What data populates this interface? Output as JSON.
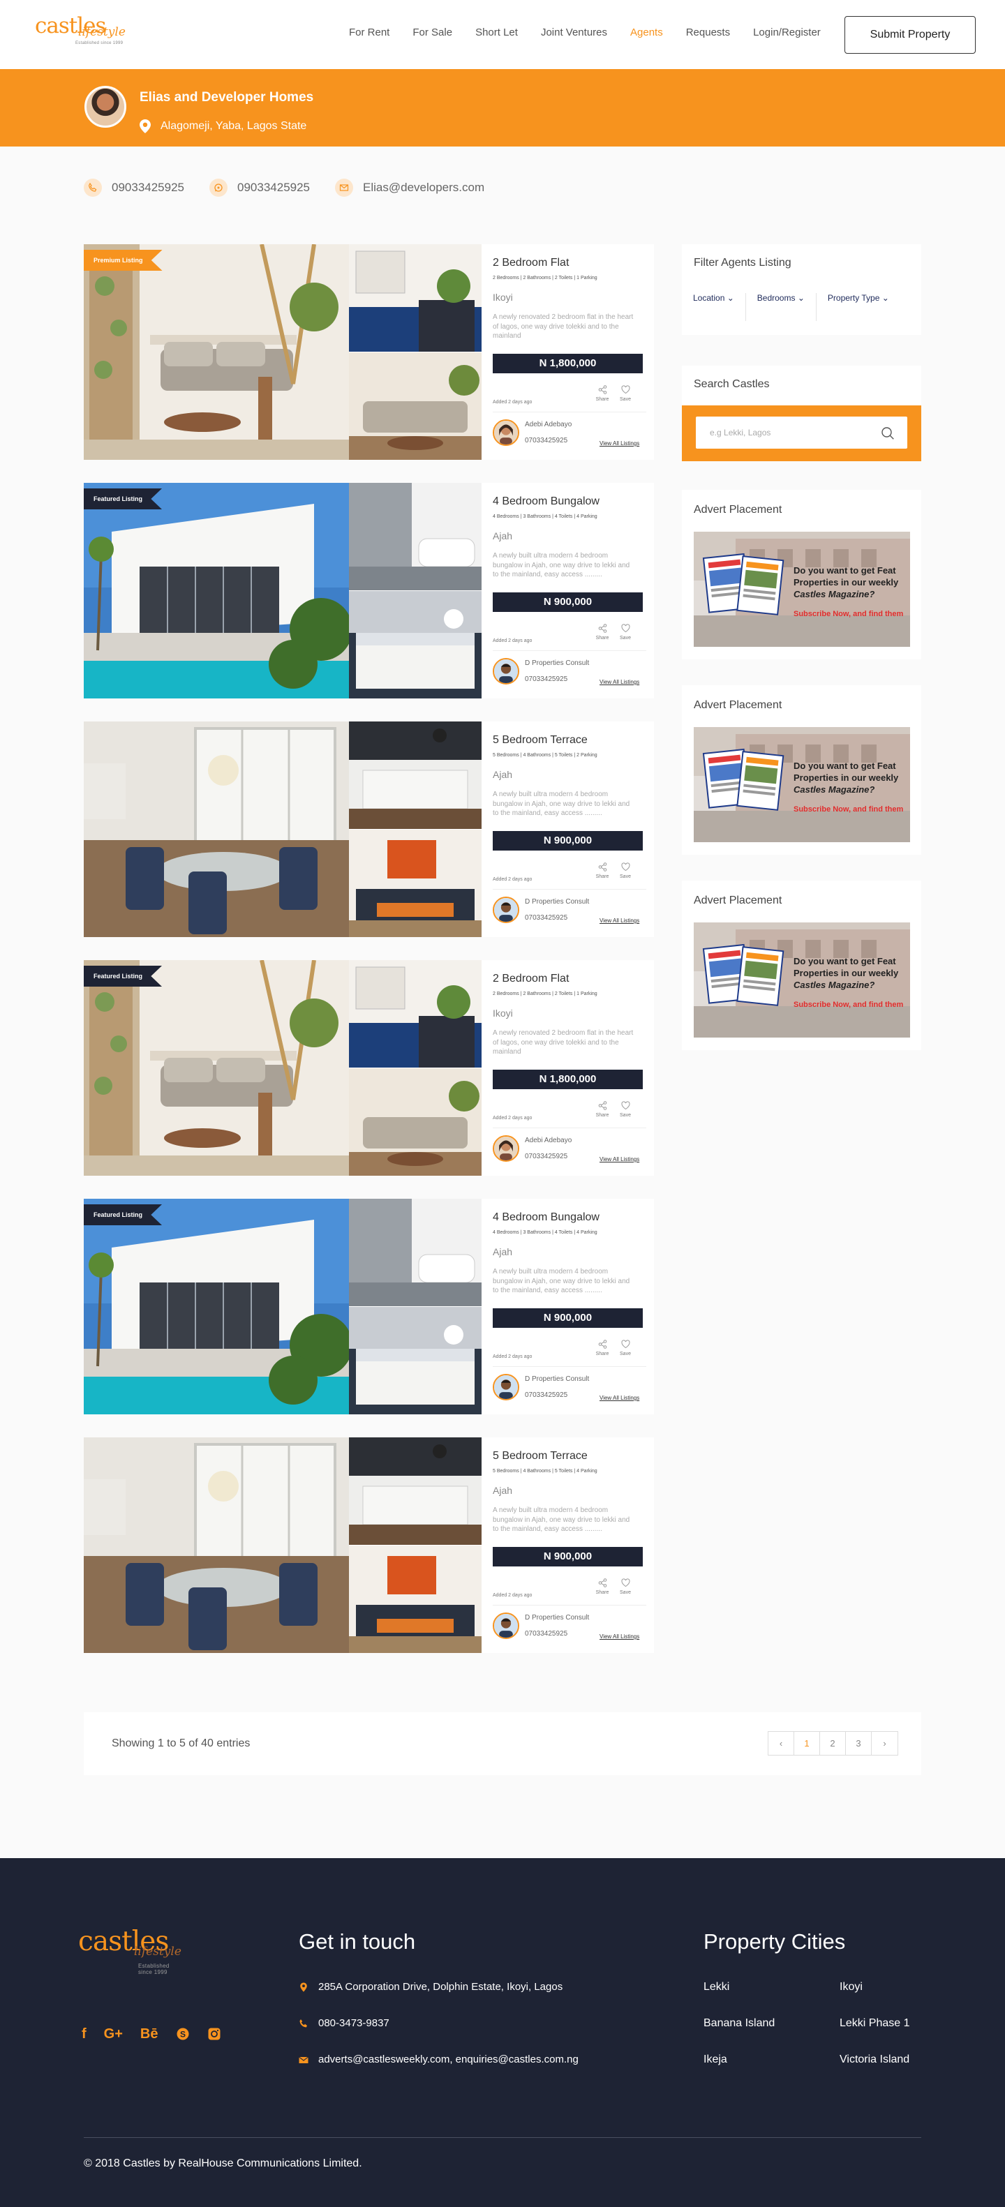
{
  "brand": {
    "name": "castles",
    "script": "lifestyle",
    "tagline": "Established since 1999"
  },
  "nav": {
    "items": [
      "For Rent",
      "For Sale",
      "Short Let",
      "Joint Ventures",
      "Agents",
      "Requests",
      "Login/Register"
    ],
    "active": "Agents",
    "submit_label": "Submit Property"
  },
  "agent": {
    "name": "Elias and Developer Homes",
    "location": "Alagomeji, Yaba, Lagos State",
    "phone": "09033425925",
    "whatsapp": "09033425925",
    "email": "Elias@developers.com"
  },
  "listings": [
    {
      "badge": "Premium Listing",
      "badge_type": "premium",
      "photo": "living",
      "title": "2 Bedroom Flat",
      "specs": "2 Bedrooms  |  2 Bathrooms  |  2 Toilets  | 1 Parking",
      "area": "Ikoyi",
      "description": "A newly renovated 2 bedroom flat in the heart of lagos, one way drive tolekki and to the mainland",
      "price": "N 1,800,000",
      "added": "Added 2 days ago",
      "share": "Share",
      "save": "Save",
      "owner": "Adebi Adebayo",
      "owner_phone": "07033425925",
      "owner_avatar": "woman",
      "view_all": "View All Listings"
    },
    {
      "badge": "Featured Listing",
      "badge_type": "featured",
      "photo": "pool",
      "title": "4 Bedroom Bungalow",
      "specs": "4 Bedrooms  |  3 Bathrooms  |  4 Toilets | 4 Parking",
      "area": "Ajah",
      "description": "A newly built ultra modern 4 bedroom bungalow in Ajah, one way drive to lekki and to the mainland, easy access .........",
      "price": "N 900,000",
      "added": "Added 2 days ago",
      "share": "Share",
      "save": "Save",
      "owner": "D Properties Consult",
      "owner_phone": "07033425925",
      "owner_avatar": "man",
      "view_all": "View All Listings"
    },
    {
      "badge": "",
      "badge_type": "none",
      "photo": "dining",
      "title": "5 Bedroom Terrace",
      "specs": "5 Bedrooms  |  4 Bathrooms  |  5 Toilets | 2 Parking",
      "area": "Ajah",
      "description": "A newly built ultra modern 4 bedroom bungalow in Ajah, one way drive to lekki and to the mainland, easy access .........",
      "price": "N 900,000",
      "added": "Added 2 days ago",
      "share": "Share",
      "save": "Save",
      "owner": "D Properties Consult",
      "owner_phone": "07033425925",
      "owner_avatar": "man",
      "view_all": "View All Listings"
    },
    {
      "badge": "Featured Listing",
      "badge_type": "featured",
      "photo": "living",
      "title": "2 Bedroom Flat",
      "specs": "2 Bedrooms  |  2 Bathrooms  |  2 Toilets  | 1 Parking",
      "area": "Ikoyi",
      "description": "A newly renovated 2 bedroom flat in the heart of lagos, one way drive tolekki and to the mainland",
      "price": "N 1,800,000",
      "added": "Added 2 days ago",
      "share": "Share",
      "save": "Save",
      "owner": "Adebi Adebayo",
      "owner_phone": "07033425925",
      "owner_avatar": "woman",
      "view_all": "View All Listings"
    },
    {
      "badge": "Featured Listing",
      "badge_type": "featured",
      "photo": "pool",
      "title": "4 Bedroom Bungalow",
      "specs": "4 Bedrooms  |  3 Bathrooms  |  4 Toilets | 4 Parking",
      "area": "Ajah",
      "description": "A newly built ultra modern 4 bedroom bungalow in Ajah, one way drive to lekki and to the mainland, easy access .........",
      "price": "N 900,000",
      "added": "Added 2 days ago",
      "share": "Share",
      "save": "Save",
      "owner": "D Properties Consult",
      "owner_phone": "07033425925",
      "owner_avatar": "man",
      "view_all": "View All Listings"
    },
    {
      "badge": "",
      "badge_type": "none",
      "photo": "dining",
      "title": "5 Bedroom Terrace",
      "specs": "5 Bedrooms  |  4 Bathrooms  |  5 Toilets | 4 Parking",
      "area": "Ajah",
      "description": "A newly built ultra modern 4 bedroom bungalow in Ajah, one way drive to lekki and to the mainland, easy access .........",
      "price": "N 900,000",
      "added": "Added 2 days ago",
      "share": "Share",
      "save": "Save",
      "owner": "D Properties Consult",
      "owner_phone": "07033425925",
      "owner_avatar": "man",
      "view_all": "View All Listings"
    }
  ],
  "sidebar": {
    "filter_title": "Filter Agents Listing",
    "filters": [
      "Location",
      "Bedrooms",
      "Property Type"
    ],
    "search_title": "Search Castles",
    "search_placeholder": "e.g Lekki, Lagos",
    "advert_title": "Advert Placement",
    "advert_text": [
      "Do you want to get Feat",
      "Properties in our weekly",
      "Castles Magazine?"
    ],
    "advert_cta": "Subscribe Now, and find them"
  },
  "pagination": {
    "showing": "Showing 1 to 5 of 40 entries",
    "pages": [
      "‹",
      "1",
      "2",
      "3",
      "›"
    ],
    "active_page": "1"
  },
  "footer": {
    "contact_title": "Get in touch",
    "address": "285A Corporation Drive, Dolphin Estate, Ikoyi, Lagos",
    "phone": "080-3473-9837",
    "email": "adverts@castlesweekly.com, enquiries@castles.com.ng",
    "cities_title": "Property Cities",
    "cities": [
      "Lekki",
      "Ikoyi",
      "Banana Island",
      "Lekki Phase 1",
      "Ikeja",
      "Victoria Island"
    ],
    "copyright": "© 2018 Castles by RealHouse Communications Limited.",
    "socials": [
      "facebook-icon",
      "google-plus-icon",
      "behance-icon",
      "skype-icon",
      "instagram-icon"
    ]
  },
  "colors": {
    "accent": "#f7931e",
    "navy": "#1e2334",
    "background": "#fafafa"
  }
}
